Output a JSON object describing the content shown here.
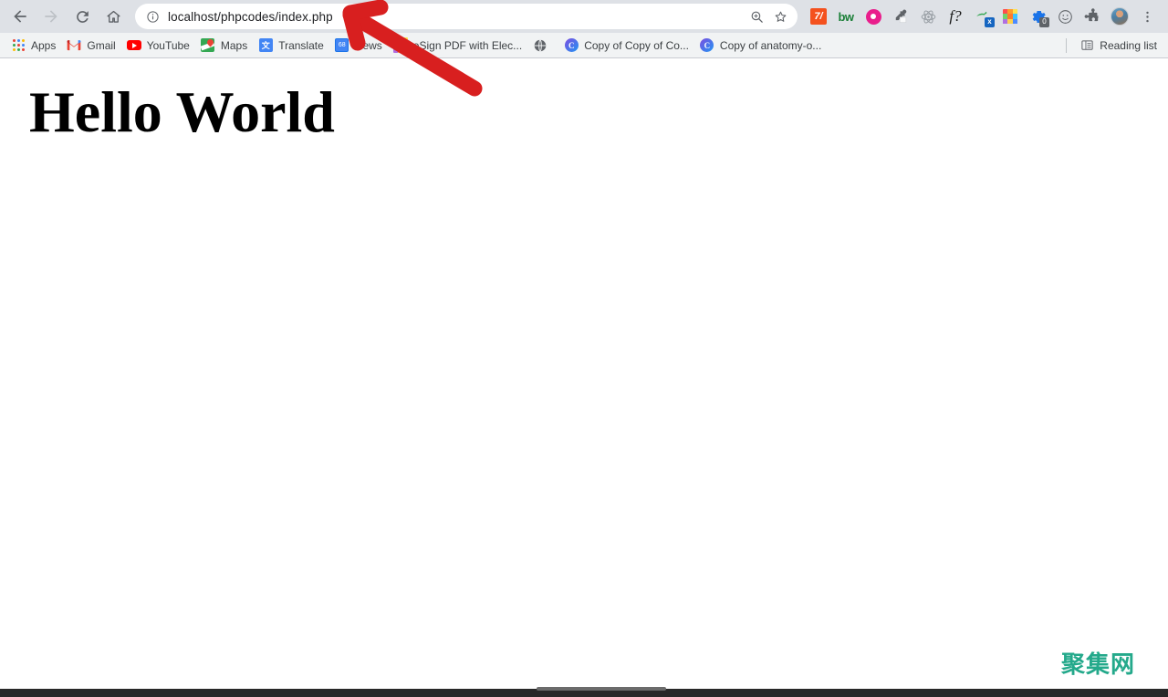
{
  "browser": {
    "nav": {
      "back_label": "Back",
      "forward_label": "Forward",
      "reload_label": "Reload",
      "home_label": "Home"
    },
    "omnibox": {
      "url": "localhost/phpcodes/index.php",
      "site_info_icon": "info-circle-icon",
      "zoom_icon": "zoom-magnifier-icon",
      "bookmark_star_icon": "star-outline-icon"
    },
    "extensions": [
      {
        "name": "seven-slash-extension-icon",
        "label": "7/",
        "color": "#f4511e"
      },
      {
        "name": "bw-extension-icon",
        "label": "bw",
        "color": "#1a7f37"
      },
      {
        "name": "eye-extension-icon",
        "label": "",
        "color": "#e91e8c"
      },
      {
        "name": "eyedropper-extension-icon",
        "label": "",
        "color": "#5f6368"
      },
      {
        "name": "atom-extension-icon",
        "label": "",
        "color": "#9aa0a6"
      },
      {
        "name": "f-question-extension-icon",
        "label": "f?",
        "color": "#1a1a1a"
      },
      {
        "name": "excel-export-extension-icon",
        "label": "x",
        "color": "#1565c0"
      },
      {
        "name": "rainbow-grid-extension-icon",
        "label": "",
        "color": "#ff5722"
      },
      {
        "name": "gear-extension-icon",
        "label": "",
        "color": "#1a73e8",
        "badge": "0"
      },
      {
        "name": "smiley-extension-icon",
        "label": "",
        "color": "#5f6368"
      },
      {
        "name": "puzzle-extensions-icon",
        "label": "",
        "color": "#5f6368"
      }
    ],
    "profile_label": "Profile",
    "menu_label": "Customize and control Google Chrome"
  },
  "bookmarks": {
    "items": [
      {
        "label": "Apps",
        "icon": "apps-grid-icon"
      },
      {
        "label": "Gmail",
        "icon": "gmail-icon"
      },
      {
        "label": "YouTube",
        "icon": "youtube-icon"
      },
      {
        "label": "Maps",
        "icon": "maps-icon"
      },
      {
        "label": "Translate",
        "icon": "translate-icon"
      },
      {
        "label": "News",
        "icon": "news-icon"
      },
      {
        "label": "eSign PDF with Elec...",
        "icon": "rainbow-grid-icon"
      },
      {
        "label": "",
        "icon": "globe-icon"
      },
      {
        "label": "Copy of Copy of Co...",
        "icon": "canva-icon"
      },
      {
        "label": "Copy of anatomy-o...",
        "icon": "canva-icon"
      }
    ],
    "reading_list": {
      "label": "Reading list",
      "icon": "reading-list-icon"
    }
  },
  "page": {
    "heading": "Hello World",
    "watermark": "聚集网"
  },
  "annotation": {
    "arrow_color": "#d81f1f",
    "description": "red-arrow-pointing-to-address-bar"
  },
  "colors": {
    "chrome_toolbar": "#dee1e6",
    "bookmarks_bar": "#f1f3f4",
    "omnibox_bg": "#ffffff",
    "page_bg": "#ffffff",
    "watermark": "#24a98b",
    "annotation_red": "#d81f1f",
    "taskbar": "#282828"
  }
}
